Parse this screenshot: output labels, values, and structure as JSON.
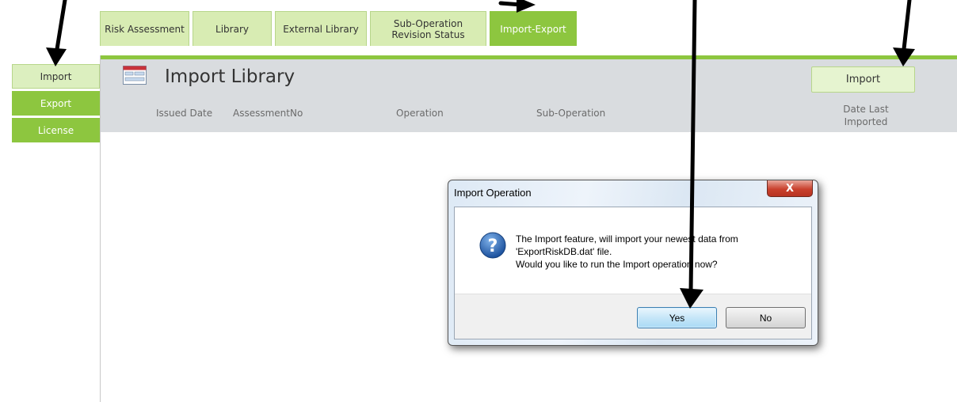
{
  "tabs": [
    {
      "label": "Risk Assessment",
      "active": false
    },
    {
      "label": "Library",
      "active": false
    },
    {
      "label": "External Library",
      "active": false
    },
    {
      "label": "Sub-Operation Revision Status",
      "active": false
    },
    {
      "label": "Import-Export",
      "active": true
    }
  ],
  "leftnav": [
    {
      "label": "Import",
      "active": true
    },
    {
      "label": "Export",
      "active": false
    },
    {
      "label": "License",
      "active": false
    }
  ],
  "header": {
    "title": "Import Library",
    "import_button": "Import",
    "columns": {
      "issued_date": "Issued Date",
      "assessment_no": "AssessmentNo",
      "operation": "Operation",
      "sub_operation": "Sub-Operation",
      "date_last_imported": "Date Last Imported"
    }
  },
  "dialog": {
    "title": "Import Operation",
    "close_label": "X",
    "message_line1": "The Import feature, will import your newest data from",
    "message_line2": "'ExportRiskDB.dat' file.",
    "message_line3": "Would you like to run the Import operation now?",
    "yes_label": "Yes",
    "no_label": "No"
  },
  "colors": {
    "accent_green": "#8dc63f",
    "light_green": "#d8ecb3",
    "header_gray": "#d9dcdf"
  }
}
